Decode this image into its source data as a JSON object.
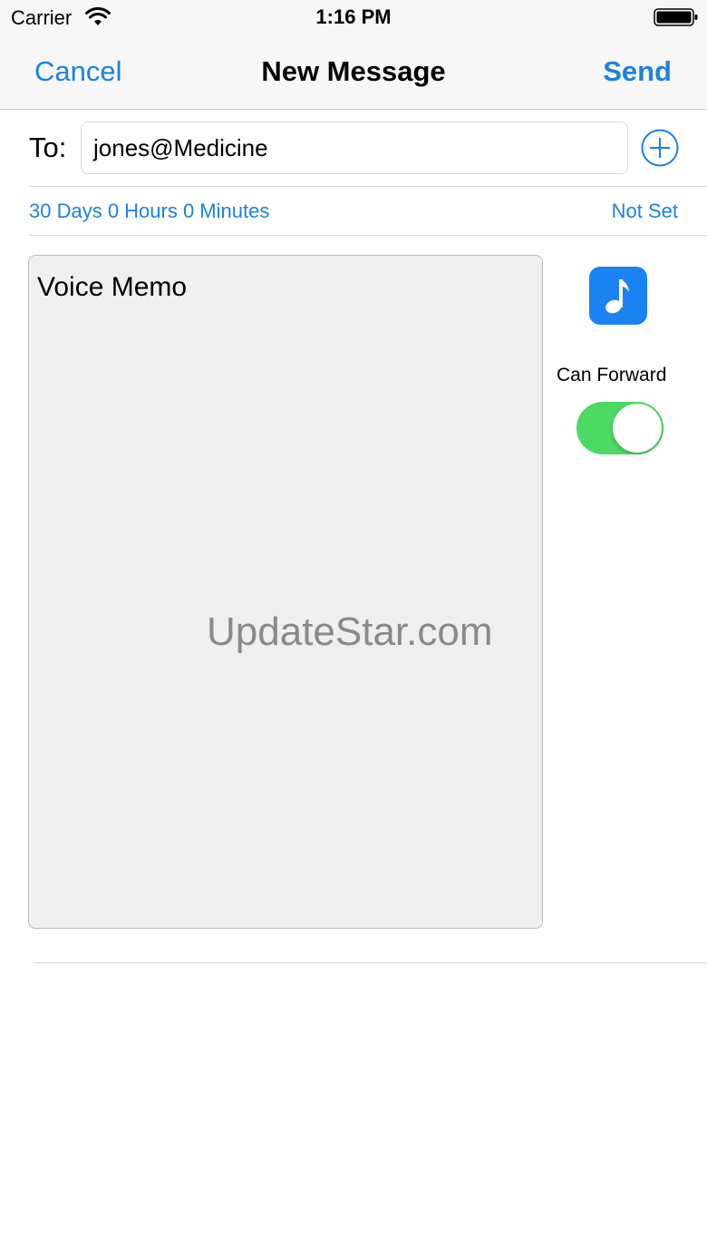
{
  "status_bar": {
    "carrier": "Carrier",
    "time": "1:16 PM",
    "wifi_icon": "wifi-icon",
    "battery_icon": "battery-icon"
  },
  "nav": {
    "cancel_label": "Cancel",
    "title": "New Message",
    "send_label": "Send",
    "accent_color": "#1a82e2"
  },
  "recipient": {
    "label": "To:",
    "value": "jones@Medicine",
    "add_icon": "plus-circle-icon"
  },
  "expiry": {
    "duration": "30 Days 0 Hours 0 Minutes",
    "status": "Not Set"
  },
  "memo": {
    "title": "Voice Memo",
    "watermark": "UpdateStar.com",
    "background_color": "#efefef"
  },
  "side_controls": {
    "music_icon": "music-note-icon",
    "music_button_color": "#1a82f2",
    "forward_label": "Can Forward",
    "forward_enabled": true,
    "toggle_color": "#4cd964"
  }
}
